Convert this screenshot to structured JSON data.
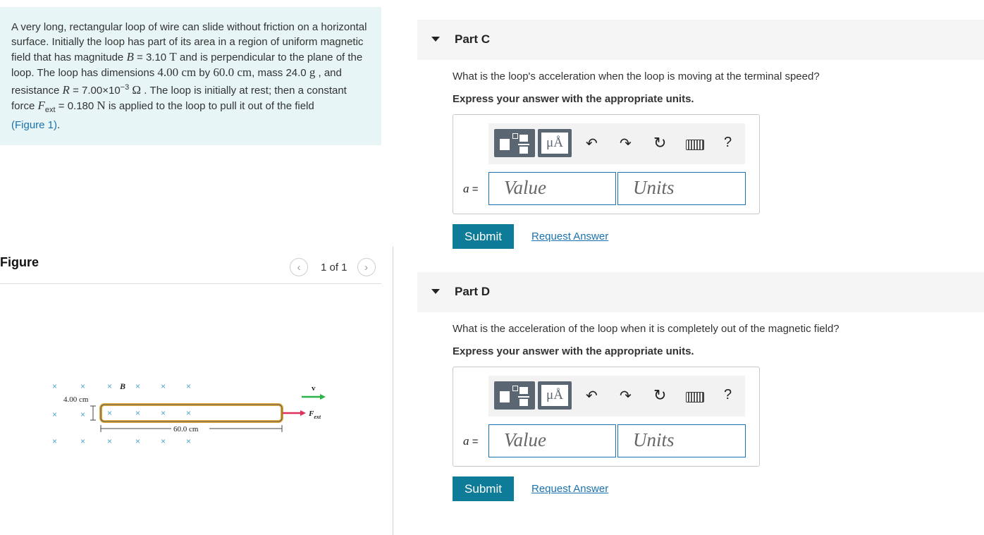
{
  "problem": {
    "t1": "A very long, rectangular loop of wire can slide without friction on a horizontal surface. Initially the loop has part of its area in a region of uniform magnetic field that has magnitude ",
    "B_sym": "B",
    "B_eq": " = 3.10 ",
    "B_unit": "T",
    "t2": " and is perpendicular to the plane of the loop. The loop has dimensions ",
    "dim1": "4.00 cm",
    "t3": " by ",
    "dim2": "60.0 cm",
    "t4": ", mass 24.0 ",
    "mass_unit": "g",
    "t5": " , and resistance ",
    "R_sym": "R",
    "R_eq": " = 7.00×10",
    "R_exp": "−3",
    "R_unit": "Ω",
    "t6": " . The loop is initially at rest; then a constant force ",
    "F_sym": "F",
    "F_sub": "ext",
    "F_eq": " = 0.180 ",
    "F_unit": "N",
    "t7": " is applied to the loop to pull it out of the field",
    "figure_link": "(Figure 1)",
    "t8": "."
  },
  "figure": {
    "heading": "Figure",
    "pager": "1 of 1",
    "prev_icon": "chevron-left-icon",
    "next_icon": "chevron-right-icon",
    "labels": {
      "width": "4.00 cm",
      "length": "60.0 cm",
      "field": "B",
      "velocity": "v",
      "force": "F",
      "force_sub": "ext"
    }
  },
  "parts": [
    {
      "title": "Part C",
      "question": "What is the loop's acceleration when the loop is moving at the terminal speed?",
      "instruction": "Express your answer with the appropriate units.",
      "var": "a",
      "eq": "=",
      "value_placeholder": "Value",
      "units_placeholder": "Units",
      "submit": "Submit",
      "request": "Request Answer"
    },
    {
      "title": "Part D",
      "question": "What is the acceleration of the loop when it is completely out of the magnetic field?",
      "instruction": "Express your answer with the appropriate units.",
      "var": "a",
      "eq": "=",
      "value_placeholder": "Value",
      "units_placeholder": "Units",
      "submit": "Submit",
      "request": "Request Answer"
    }
  ],
  "toolbar": {
    "units_button": "μÅ",
    "help": "?",
    "icons": [
      "templates-icon",
      "units-icon",
      "undo-icon",
      "redo-icon",
      "reset-icon",
      "keyboard-icon",
      "help-icon"
    ]
  },
  "colors": {
    "problem_bg": "#e7f5f6",
    "link": "#1a73b0",
    "submit_bg": "#0e7c98",
    "field_border": "#1a73b0"
  }
}
